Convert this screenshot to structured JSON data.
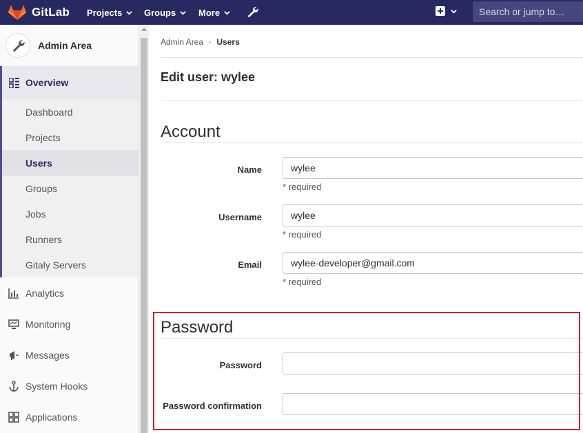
{
  "navbar": {
    "brand": "GitLab",
    "projects": "Projects",
    "groups": "Groups",
    "more": "More",
    "search_placeholder": "Search or jump to…"
  },
  "sidebar": {
    "title": "Admin Area",
    "overview": "Overview",
    "sub_items": [
      "Dashboard",
      "Projects",
      "Users",
      "Groups",
      "Jobs",
      "Runners",
      "Gitaly Servers"
    ],
    "active_sub": "Users",
    "items": [
      {
        "label": "Analytics",
        "icon": "chart-icon"
      },
      {
        "label": "Monitoring",
        "icon": "monitor-icon"
      },
      {
        "label": "Messages",
        "icon": "megaphone-icon"
      },
      {
        "label": "System Hooks",
        "icon": "anchor-icon"
      },
      {
        "label": "Applications",
        "icon": "apps-grid-icon"
      }
    ]
  },
  "breadcrumb": {
    "root": "Admin Area",
    "current": "Users"
  },
  "page_title": "Edit user: wylee",
  "account": {
    "title": "Account",
    "name_label": "Name",
    "name_value": "wylee",
    "username_label": "Username",
    "username_value": "wylee",
    "email_label": "Email",
    "email_value": "wylee-developer@gmail.com",
    "required": "* required"
  },
  "password": {
    "title": "Password",
    "password_label": "Password",
    "password_value": "",
    "confirm_label": "Password confirmation",
    "confirm_value": ""
  },
  "colors": {
    "navbar": "#292961",
    "highlight": "#d0202b",
    "accent": "#4b4ba3"
  }
}
